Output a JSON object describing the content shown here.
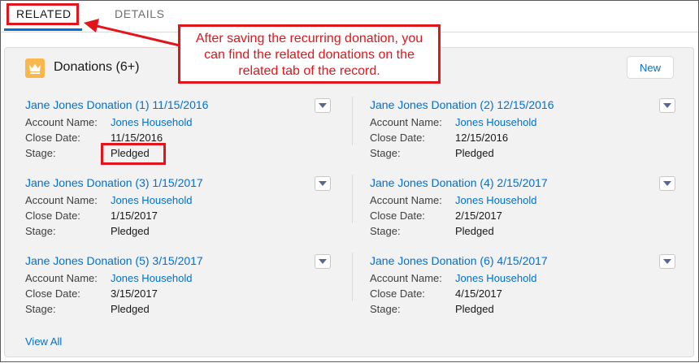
{
  "tabs": [
    {
      "label": "RELATED",
      "active": true
    },
    {
      "label": "DETAILS",
      "active": false
    }
  ],
  "callout": {
    "text": "After saving the recurring donation, you can find the related donations on the related tab of the record."
  },
  "card": {
    "icon": "crown-icon",
    "title": "Donations (6+)",
    "new_label": "New",
    "view_all_label": "View All"
  },
  "labels": {
    "account_name": "Account Name:",
    "close_date": "Close Date:",
    "stage": "Stage:"
  },
  "donations": [
    {
      "title": "Jane Jones Donation (1) 11/15/2016",
      "account": "Jones Household",
      "close_date": "11/15/2016",
      "stage": "Pledged"
    },
    {
      "title": "Jane Jones Donation (2) 12/15/2016",
      "account": "Jones Household",
      "close_date": "12/15/2016",
      "stage": "Pledged"
    },
    {
      "title": "Jane Jones Donation (3) 1/15/2017",
      "account": "Jones Household",
      "close_date": "1/15/2017",
      "stage": "Pledged"
    },
    {
      "title": "Jane Jones Donation (4) 2/15/2017",
      "account": "Jones Household",
      "close_date": "2/15/2017",
      "stage": "Pledged"
    },
    {
      "title": "Jane Jones Donation (5) 3/15/2017",
      "account": "Jones Household",
      "close_date": "3/15/2017",
      "stage": "Pledged"
    },
    {
      "title": "Jane Jones Donation (6) 4/15/2017",
      "account": "Jones Household",
      "close_date": "4/15/2017",
      "stage": "Pledged"
    }
  ],
  "colors": {
    "accent": "#0070d2",
    "annotation": "#e2151b",
    "icon_bg": "#f8b84e"
  }
}
